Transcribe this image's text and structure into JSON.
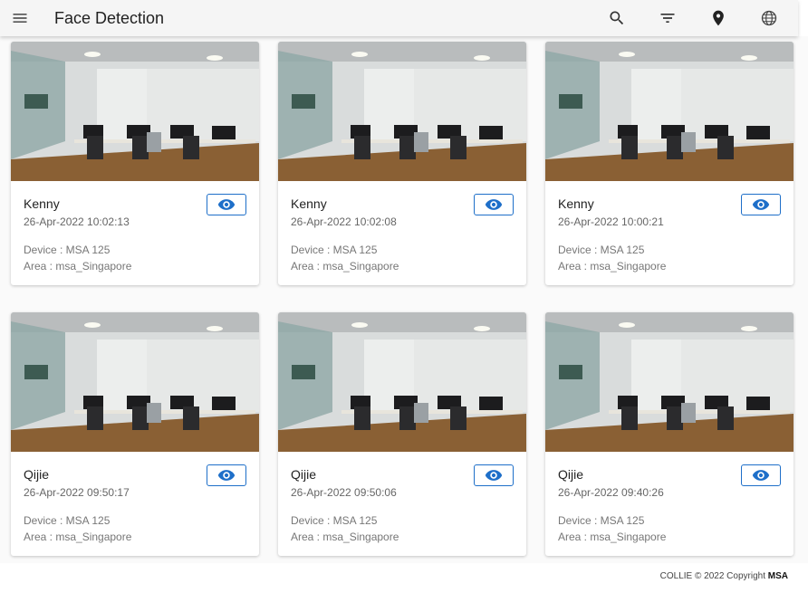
{
  "header": {
    "title": "Face Detection",
    "actions": [
      "search-icon",
      "filter-icon",
      "location-pin-icon",
      "globe-icon"
    ]
  },
  "cards": [
    {
      "name": "Kenny",
      "time": "26-Apr-2022 10:02:13",
      "device": "Device : MSA 125",
      "area": "Area : msa_Singapore"
    },
    {
      "name": "Kenny",
      "time": "26-Apr-2022 10:02:08",
      "device": "Device : MSA 125",
      "area": "Area : msa_Singapore"
    },
    {
      "name": "Kenny",
      "time": "26-Apr-2022 10:00:21",
      "device": "Device : MSA 125",
      "area": "Area : msa_Singapore"
    },
    {
      "name": "Qijie",
      "time": "26-Apr-2022 09:50:17",
      "device": "Device : MSA 125",
      "area": "Area : msa_Singapore"
    },
    {
      "name": "Qijie",
      "time": "26-Apr-2022 09:50:06",
      "device": "Device : MSA 125",
      "area": "Area : msa_Singapore"
    },
    {
      "name": "Qijie",
      "time": "26-Apr-2022 09:40:26",
      "device": "Device : MSA 125",
      "area": "Area : msa_Singapore"
    }
  ],
  "footer": {
    "prefix": "COLLIE © 2022 Copyright ",
    "brand": "MSA"
  },
  "colors": {
    "accent": "#1e6fc9",
    "topbar": "#f5f5f5"
  }
}
